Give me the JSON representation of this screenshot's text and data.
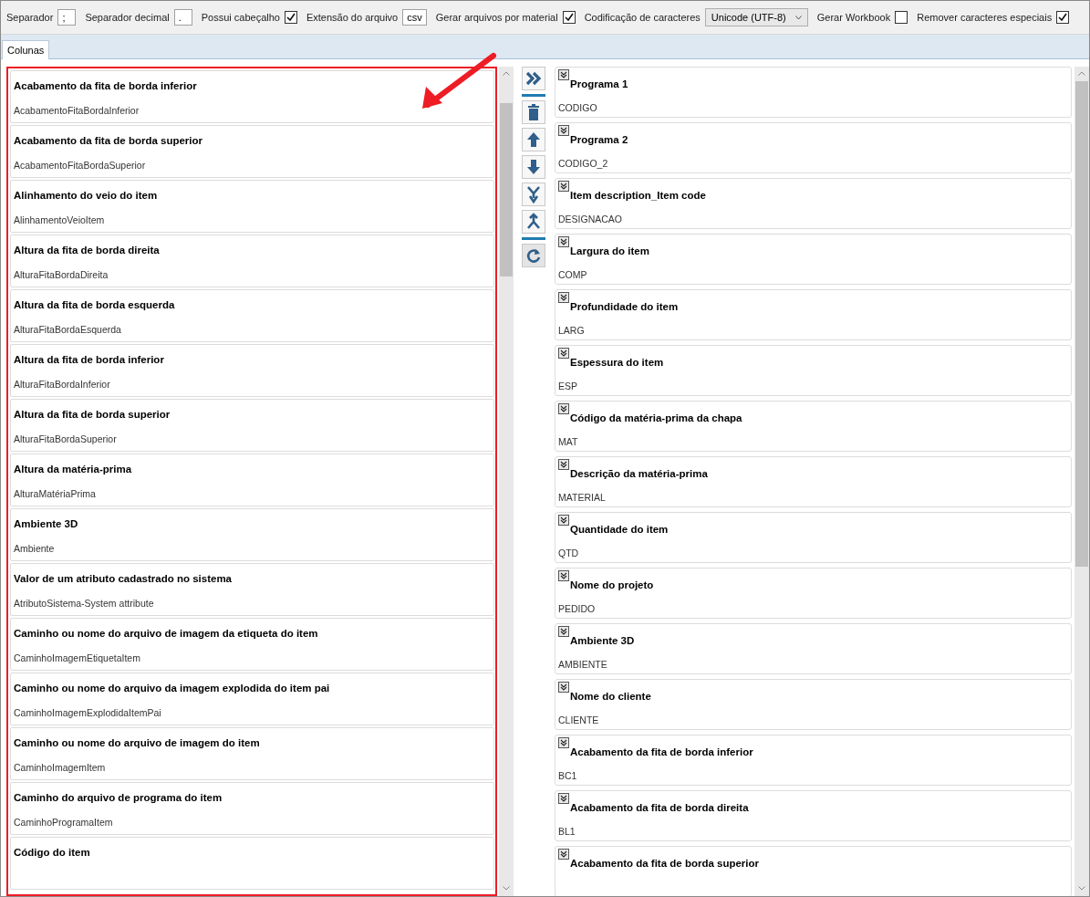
{
  "toolbar": [
    {
      "kind": "text",
      "label": "Separador",
      "value": ";"
    },
    {
      "kind": "text",
      "label": "Separador decimal",
      "value": "."
    },
    {
      "kind": "check",
      "label": "Possui cabeçalho",
      "checked": true
    },
    {
      "kind": "text",
      "label": "Extensão do arquivo",
      "value": "csv"
    },
    {
      "kind": "check",
      "label": "Gerar arquivos por material",
      "checked": true
    },
    {
      "kind": "select",
      "label": "Codificação de caracteres",
      "value": "Unicode (UTF-8)"
    },
    {
      "kind": "check",
      "label": "Gerar Workbook",
      "checked": false
    },
    {
      "kind": "check",
      "label": "Remover caracteres especiais",
      "checked": true
    }
  ],
  "tabs": [
    {
      "label": "Colunas",
      "selected": true
    }
  ],
  "available_columns": [
    {
      "title": "Acabamento da fita de borda inferior",
      "name": "AcabamentoFitaBordaInferior"
    },
    {
      "title": "Acabamento da fita de borda superior",
      "name": "AcabamentoFitaBordaSuperior"
    },
    {
      "title": "Alinhamento do veio do item",
      "name": "AlinhamentoVeioItem"
    },
    {
      "title": "Altura da fita de borda direita",
      "name": "AlturaFitaBordaDireita"
    },
    {
      "title": "Altura da fita de borda esquerda",
      "name": "AlturaFitaBordaEsquerda"
    },
    {
      "title": "Altura da fita de borda inferior",
      "name": "AlturaFitaBordaInferior"
    },
    {
      "title": "Altura da fita de borda superior",
      "name": "AlturaFitaBordaSuperior"
    },
    {
      "title": "Altura da matéria-prima",
      "name": "AlturaMatériaPrima"
    },
    {
      "title": "Ambiente 3D",
      "name": "Ambiente"
    },
    {
      "title": "Valor de um atributo cadastrado no sistema",
      "name": "AtributoSistema-System attribute"
    },
    {
      "title": "Caminho ou nome do arquivo de imagem da etiqueta do item",
      "name": "CaminhoImagemEtiquetaItem"
    },
    {
      "title": "Caminho ou nome do arquivo da imagem explodida do item pai",
      "name": "CaminhoImagemExplodidaItemPai"
    },
    {
      "title": "Caminho ou nome do arquivo de imagem do item",
      "name": "CaminhoImagemItem"
    },
    {
      "title": "Caminho do arquivo de programa do item",
      "name": "CaminhoProgramaItem"
    },
    {
      "title": "Código do item"
    }
  ],
  "selected_columns": [
    {
      "title": "Programa 1",
      "name": "CODIGO"
    },
    {
      "title": "Programa 2",
      "name": "CODIGO_2"
    },
    {
      "title": "Item description_Item code",
      "name": "DESIGNACAO"
    },
    {
      "title": "Largura do item",
      "name": "COMP"
    },
    {
      "title": "Profundidade do item",
      "name": "LARG"
    },
    {
      "title": "Espessura do item",
      "name": "ESP"
    },
    {
      "title": "Código da matéria-prima da chapa",
      "name": "MAT"
    },
    {
      "title": "Descrição da matéria-prima",
      "name": "MATERIAL"
    },
    {
      "title": "Quantidade do item",
      "name": "QTD"
    },
    {
      "title": "Nome do projeto",
      "name": "PEDIDO"
    },
    {
      "title": "Ambiente 3D",
      "name": "AMBIENTE"
    },
    {
      "title": "Nome do cliente",
      "name": "CLIENTE"
    },
    {
      "title": "Acabamento da fita de borda inferior",
      "name": "BC1"
    },
    {
      "title": "Acabamento da fita de borda direita",
      "name": "BL1"
    },
    {
      "title": "Acabamento da fita de borda superior"
    }
  ]
}
